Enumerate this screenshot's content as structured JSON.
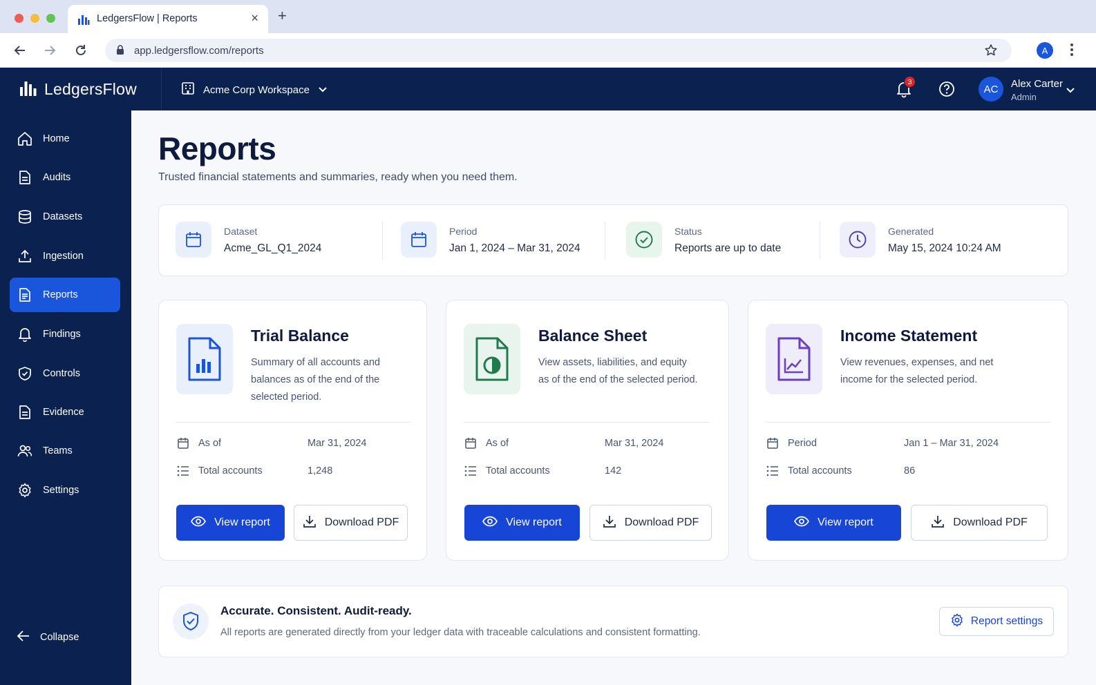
{
  "browser": {
    "tab_title": "LedgersFlow | Reports",
    "url": "app.ledgersflow.com/reports",
    "profile_initial": "A"
  },
  "header": {
    "brand": "LedgersFlow",
    "workspace": "Acme Corp Workspace",
    "notification_count": "3",
    "user_initials": "AC",
    "user_name": "Alex Carter",
    "user_role": "Admin"
  },
  "sidebar": {
    "items": [
      {
        "label": "Home",
        "icon": "home-icon"
      },
      {
        "label": "Audits",
        "icon": "audits-icon"
      },
      {
        "label": "Datasets",
        "icon": "database-icon"
      },
      {
        "label": "Ingestion",
        "icon": "upload-icon"
      },
      {
        "label": "Reports",
        "icon": "reports-icon",
        "active": true
      },
      {
        "label": "Findings",
        "icon": "bell-icon"
      },
      {
        "label": "Controls",
        "icon": "shield-check-icon"
      },
      {
        "label": "Evidence",
        "icon": "document-icon"
      },
      {
        "label": "Teams",
        "icon": "users-icon"
      },
      {
        "label": "Settings",
        "icon": "gear-icon"
      }
    ],
    "collapse_label": "Collapse"
  },
  "page": {
    "title": "Reports",
    "subtitle": "Trusted financial statements and summaries, ready when you need them."
  },
  "meta": {
    "dataset": {
      "label": "Dataset",
      "value": "Acme_GL_Q1_2024"
    },
    "period": {
      "label": "Period",
      "value": "Jan 1, 2024 – Mar 31, 2024"
    },
    "status": {
      "label": "Status",
      "value": "Reports are up to date"
    },
    "generated": {
      "label": "Generated",
      "value": "May 15, 2024 10:24 AM"
    }
  },
  "reports": [
    {
      "title": "Trial Balance",
      "description": "Summary of all accounts and balances as of the end of the selected period.",
      "row1_label": "As of",
      "row1_value": "Mar 31, 2024",
      "row2_label": "Total accounts",
      "row2_value": "1,248",
      "view_label": "View report",
      "download_label": "Download PDF",
      "accent": "#1a56db"
    },
    {
      "title": "Balance Sheet",
      "description": "View assets, liabilities, and equity as of the end of the selected period.",
      "row1_label": "As of",
      "row1_value": "Mar 31, 2024",
      "row2_label": "Total accounts",
      "row2_value": "142",
      "view_label": "View report",
      "download_label": "Download PDF",
      "accent": "#1f7a4d"
    },
    {
      "title": "Income Statement",
      "description": "View revenues, expenses, and net income for the selected period.",
      "row1_label": "Period",
      "row1_value": "Jan 1 – Mar 31, 2024",
      "row2_label": "Total accounts",
      "row2_value": "86",
      "view_label": "View report",
      "download_label": "Download PDF",
      "accent": "#6a3fc4"
    }
  ],
  "footer": {
    "title": "Accurate. Consistent. Audit-ready.",
    "text": "All reports are generated directly from your ledger data with traceable calculations and consistent formatting.",
    "button_label": "Report settings"
  },
  "colors": {
    "navy": "#0b2150",
    "primary": "#1746d6",
    "badge": "#e02424"
  }
}
